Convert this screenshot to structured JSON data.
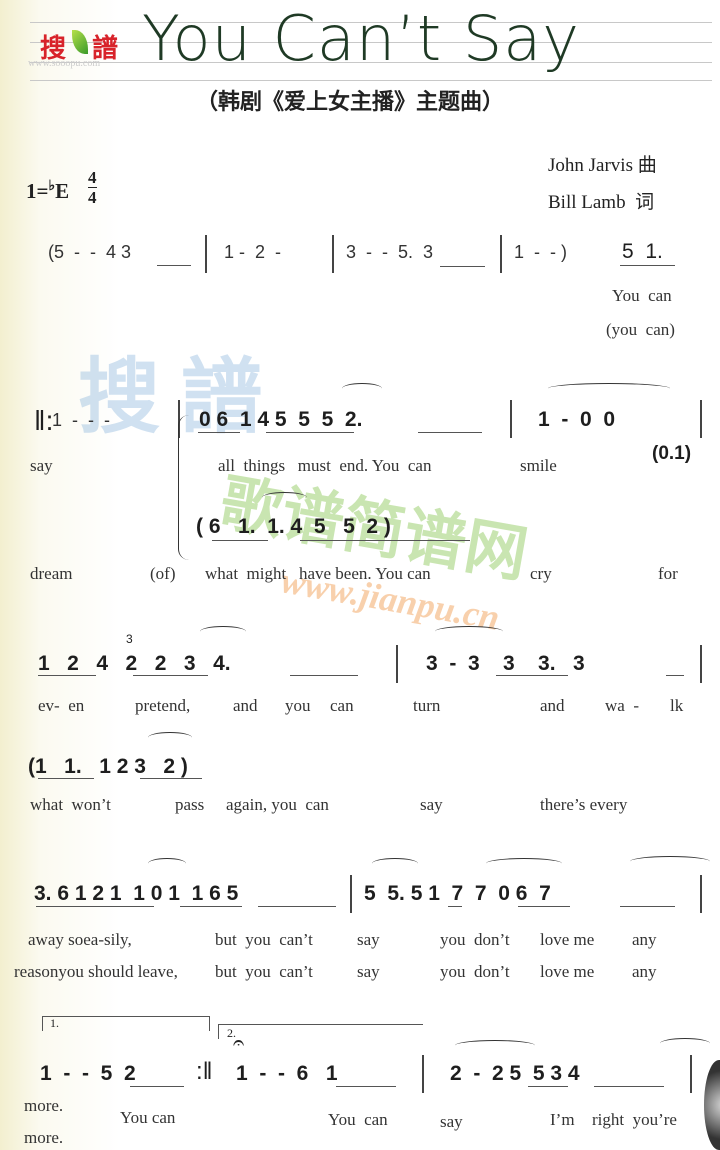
{
  "header": {
    "logo_left": "搜",
    "logo_right": "譜",
    "logo_url": "www.sooopu.com",
    "title": "You Can’t Say",
    "subtitle": "（韩剧《爱上女主播》主题曲）",
    "composer": "John Jarvis 曲",
    "lyricist": "Bill Lamb  词",
    "key_prefix": "1=",
    "key_flat": "♭",
    "key_note": "E",
    "time_top": "4",
    "time_bottom": "4"
  },
  "watermarks": {
    "blue": "搜 譜",
    "green": "歌谱简谱网",
    "orange": "www.jianpu.cn"
  },
  "system1": {
    "notes": [
      "(5  -  -  4 3",
      "1 -  2  -",
      "3  -  -  5.  3",
      "1  -  - )",
      "5  1."
    ],
    "lyrics": [
      "You  can",
      "(you  can)"
    ]
  },
  "system2": {
    "repeat_start": "‖:",
    "notes": [
      "1  -  -  -",
      "0 6  1 4 5  5  5  2.",
      "1  -  0  0",
      "(0.1)"
    ],
    "lyrics": [
      "say",
      "all  things   must  end. You  can",
      "smile"
    ]
  },
  "system3": {
    "notes": [
      "( 6   1.  1. 4  5   5  2 )"
    ],
    "lyrics": [
      "dream",
      "(of)",
      "what  might   have been. You can",
      "cry",
      "for"
    ]
  },
  "system4": {
    "triplet": "3",
    "notes": [
      "1   2   4   2   2   3   4.",
      "3  -  3    3    3.   3"
    ],
    "lyrics": [
      "ev-  en",
      "pretend,",
      "and",
      "you",
      "can",
      "turn",
      "and",
      "wa  -",
      "lk"
    ]
  },
  "system5": {
    "notes": [
      "(1   1.   1 2 3   2 )"
    ],
    "lyrics": [
      "what  won’t",
      "pass",
      "again, you  can",
      "say",
      "there’s every"
    ]
  },
  "system6": {
    "notes": [
      "3. 6 1 2 1  1 0 1  1 6 5",
      "5  5. 5 1  7  7  0 6  7"
    ],
    "lyrics_1": [
      "away soea-sily,",
      "but  you  can’t",
      "say",
      "you  don’t",
      "love me",
      "any"
    ],
    "lyrics_2": [
      "reasonyou should leave,",
      "but  you  can’t",
      "say",
      "you  don’t",
      "love me",
      "any"
    ]
  },
  "system7": {
    "volta_1": "1.",
    "volta_2": "2.",
    "fermata": "𝄐",
    "repeat_end": ":‖",
    "notes": [
      "1  -  -  5  2",
      "1  -  -  6   1",
      "2  -  2 5  5 3 4"
    ],
    "lyrics_1": [
      "more.",
      "You can",
      "You  can",
      "say",
      "I’m",
      "right  you’re"
    ],
    "lyrics_2": [
      "more."
    ]
  }
}
